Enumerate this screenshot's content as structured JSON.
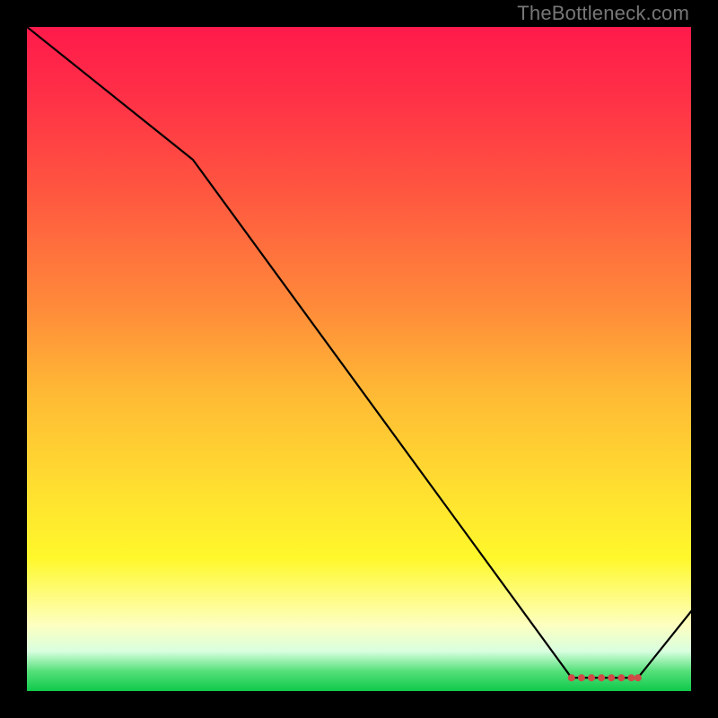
{
  "watermark": "TheBottleneck.com",
  "colors": {
    "background": "#000000",
    "gradient_top": "#ff1a4b",
    "gradient_mid": "#ffe030",
    "gradient_bottom": "#0fc94a",
    "line": "#000000",
    "marker": "#d04a47"
  },
  "chart_data": {
    "type": "line",
    "title": "",
    "xlabel": "",
    "ylabel": "",
    "xlim": [
      0,
      100
    ],
    "ylim": [
      0,
      100
    ],
    "x": [
      0,
      25,
      82,
      92,
      100
    ],
    "y": [
      100,
      80,
      2,
      2,
      12
    ],
    "markers_x": [
      82,
      83.5,
      85,
      86.5,
      88,
      89.5,
      91,
      92
    ],
    "markers_y": [
      2,
      2,
      2,
      2,
      2,
      2,
      2,
      2
    ],
    "description": "Single black curve starting at top-left (y≈100), gently decreasing to ~(25,80), then steeply descending to a floor near y≈2 around x≈82–92, with a slight uptick to ~(100,12). Cluster of small red markers along the floor segment.",
    "background_gradient": {
      "orientation": "vertical",
      "stops": [
        {
          "pos": 0.0,
          "color": "#ff1a4b"
        },
        {
          "pos": 0.55,
          "color": "#ffb935"
        },
        {
          "pos": 0.8,
          "color": "#fff82b"
        },
        {
          "pos": 0.97,
          "color": "#55e07a"
        },
        {
          "pos": 1.0,
          "color": "#0fc94a"
        }
      ]
    }
  }
}
